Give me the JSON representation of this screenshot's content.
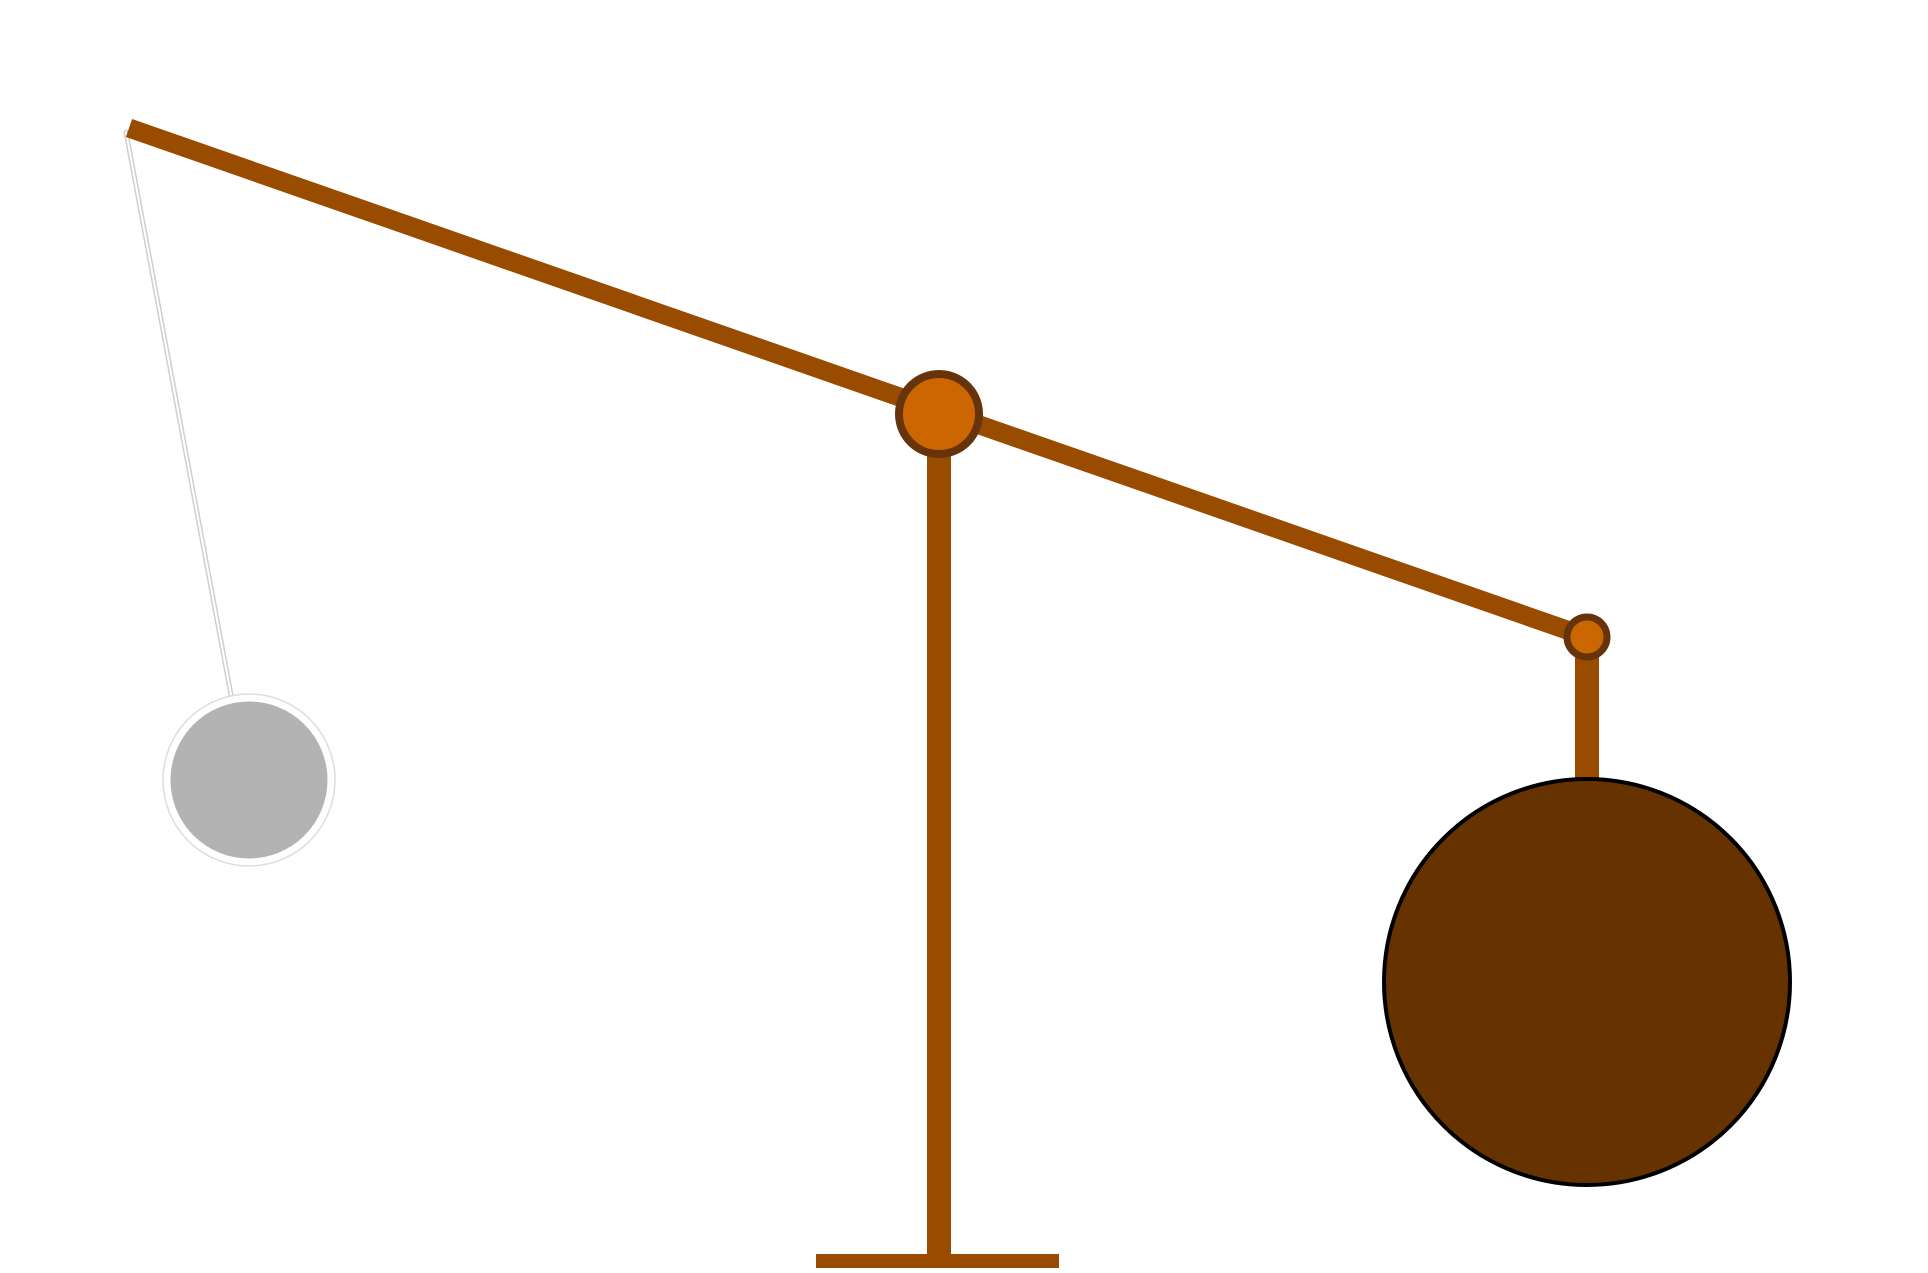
{
  "scene": {
    "background_color": "#ffffff",
    "beam_color": "#994c00",
    "pivot_fill": "#cc6600",
    "pivot_stroke": "#66330a",
    "counterweight_fill": "#663300",
    "counterweight_stroke": "#000000",
    "ghost_bob_fill": "#b3b3b3",
    "ghost_string_color": "#bbbbbb",
    "icons": [
      "pivot-joint-icon",
      "end-joint-icon",
      "counterweight-icon",
      "pendulum-bob-icon"
    ]
  }
}
